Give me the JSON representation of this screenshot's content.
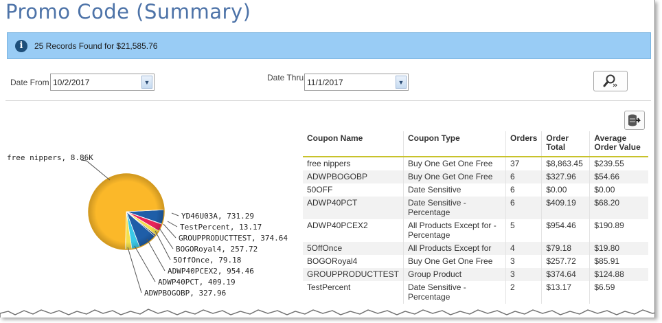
{
  "title": "Promo Code (Summary)",
  "alert": {
    "icon": "info-icon",
    "text": "25 Records Found for $21,585.76"
  },
  "filters": {
    "date_from_label": "Date From",
    "date_from_value": "10/2/2017",
    "date_thru_label": "Date Thru",
    "date_thru_value": "11/1/2017",
    "search_icon": "search-icon"
  },
  "export_icon": "export-icon",
  "chart_data": {
    "type": "pie",
    "slices": [
      {
        "label": "free nippers, 8.86K",
        "value": 8863.45,
        "color": "#fbb829"
      },
      {
        "label": "YD46U03A, 731.29",
        "value": 731.29,
        "color": "#1f5ea8"
      },
      {
        "label": "TestPercent, 13.17",
        "value": 13.17,
        "color": "#6c2a8c"
      },
      {
        "label": "GROUPPRODUCTTEST, 374.64",
        "value": 374.64,
        "color": "#e8245a"
      },
      {
        "label": "BOGORoyal4, 257.72",
        "value": 257.72,
        "color": "#f4e04d"
      },
      {
        "label": "5OffOnce, 79.18",
        "value": 79.18,
        "color": "#0d2a55"
      },
      {
        "label": "ADWP40PCEX2, 954.46",
        "value": 954.46,
        "color": "#1f5ea8"
      },
      {
        "label": "ADWP40PCT, 409.19",
        "value": 409.19,
        "color": "#3ac9e8"
      },
      {
        "label": "ADWPBOGOBP, 327.96",
        "value": 327.96,
        "color": "#f4e04d"
      }
    ]
  },
  "table": {
    "headers": [
      "Coupon Name",
      "Coupon Type",
      "Orders",
      "Order Total",
      "Average Order Value"
    ],
    "rows": [
      [
        "free nippers",
        "Buy One Get One Free",
        "37",
        "$8,863.45",
        "$239.55"
      ],
      [
        "ADWPBOGOBP",
        "Buy One Get One Free",
        "6",
        "$327.96",
        "$54.66"
      ],
      [
        "50OFF",
        "Date Sensitive",
        "6",
        "$0.00",
        "$0.00"
      ],
      [
        "ADWP40PCT",
        "Date Sensitive - Percentage",
        "6",
        "$409.19",
        "$68.20"
      ],
      [
        "ADWP40PCEX2",
        "All Products Except for - Percentage",
        "5",
        "$954.46",
        "$190.89"
      ],
      [
        "5OffOnce",
        "All Products Except for",
        "4",
        "$79.18",
        "$19.80"
      ],
      [
        "BOGORoyal4",
        "Buy One Get One Free",
        "3",
        "$257.72",
        "$85.91"
      ],
      [
        "GROUPPRODUCTTEST",
        "Group Product",
        "3",
        "$374.64",
        "$124.88"
      ],
      [
        "TestPercent",
        "Date Sensitive - Percentage",
        "2",
        "$13.17",
        "$6.59"
      ]
    ]
  }
}
